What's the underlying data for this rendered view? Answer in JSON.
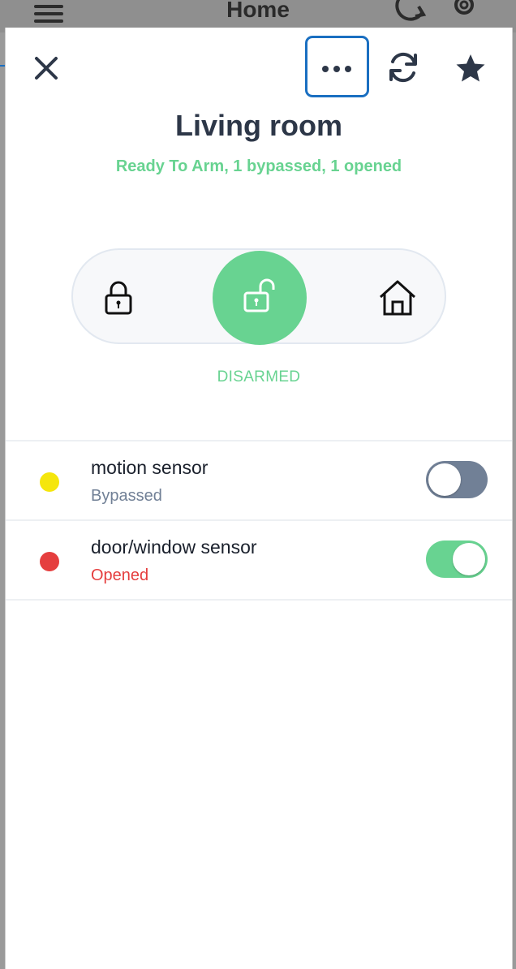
{
  "background": {
    "title": "Home",
    "icons": [
      "menu-icon",
      "refresh-icon",
      "gear-icon"
    ]
  },
  "toolbar": {
    "close_icon": "close-icon",
    "more_icon": "more-horizontal-icon",
    "refresh_icon": "refresh-icon",
    "favorite_icon": "star-icon"
  },
  "panel": {
    "title": "Living room",
    "subtitle": "Ready To Arm, 1 bypassed, 1 opened"
  },
  "arm_modes": {
    "options": [
      "away-lock-icon",
      "disarm-unlock-icon",
      "home-icon"
    ],
    "selected": "disarm-unlock-icon",
    "state_label": "DISARMED"
  },
  "sensors": [
    {
      "name": "motion sensor",
      "status": "Bypassed",
      "dot_color": "#f5e60c",
      "status_color": "#718096",
      "toggle_on": false
    },
    {
      "name": "door/window sensor",
      "status": "Opened",
      "dot_color": "#e53e3e",
      "status_color": "#e53e3e",
      "toggle_on": true
    }
  ],
  "colors": {
    "accent": "#68d391",
    "highlight": "#1a6fc1",
    "toggle_off": "#718096",
    "text_dark": "#2d3748"
  }
}
